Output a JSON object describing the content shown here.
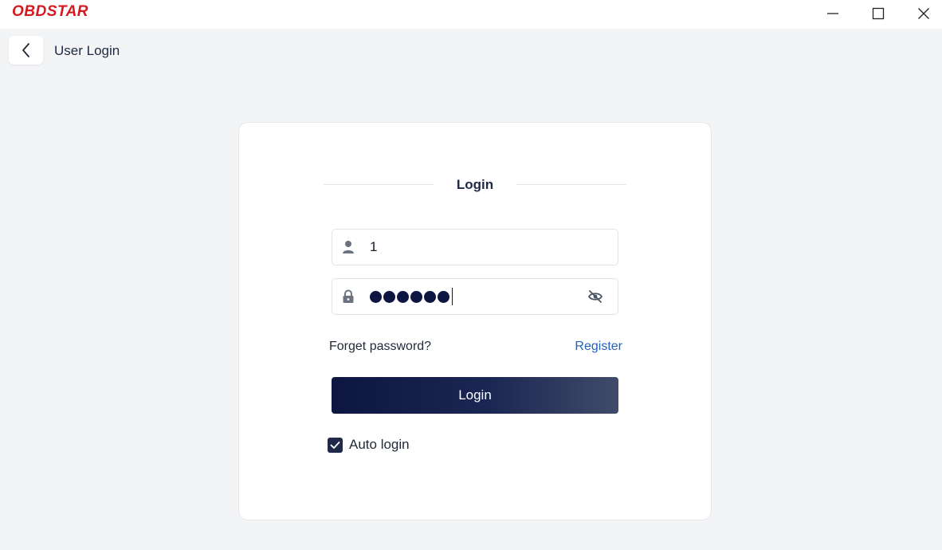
{
  "app": {
    "logo_text": "OBDSTAR",
    "brand_color": "#d41a1f"
  },
  "window_controls": {
    "minimize_icon": "minimize-icon",
    "maximize_icon": "maximize-icon",
    "close_icon": "close-icon"
  },
  "header": {
    "back_icon": "chevron-left-icon",
    "title": "User Login"
  },
  "login_card": {
    "title": "Login",
    "username": {
      "icon": "user-icon",
      "value": "1"
    },
    "password": {
      "icon": "lock-icon",
      "masked_length": 6,
      "toggle_icon": "eye-off-icon"
    },
    "forget_password": "Forget password?",
    "register": "Register",
    "login_button": "Login",
    "auto_login": {
      "label": "Auto login",
      "checked": true
    }
  },
  "colors": {
    "accent_dark": "#0d1640",
    "link": "#2563b8"
  }
}
